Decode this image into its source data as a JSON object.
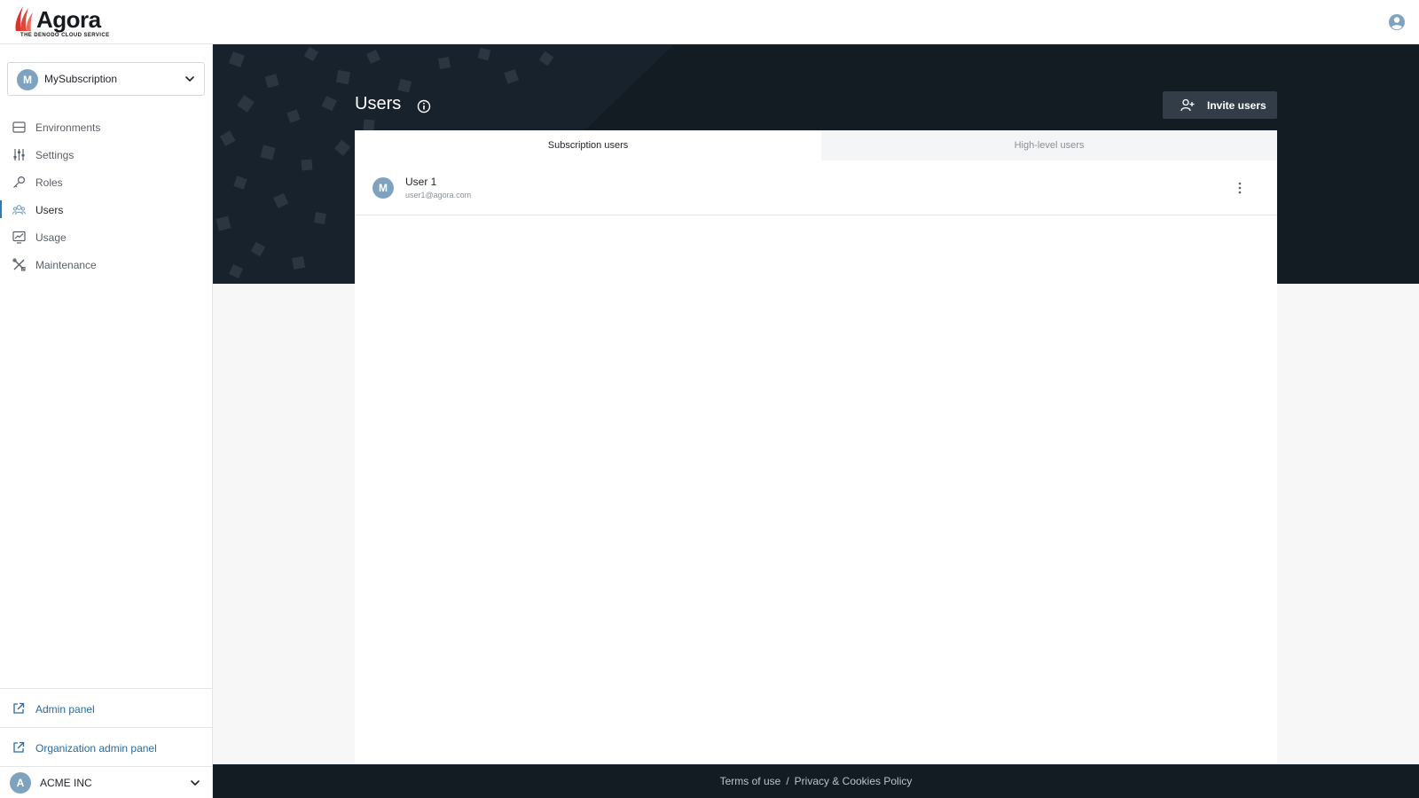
{
  "header": {
    "brand_name": "Agora",
    "brand_tagline": "THE DENODO CLOUD SERVICE",
    "profile_icon": "user-circle-icon"
  },
  "sidebar": {
    "subscription": {
      "initial": "M",
      "name": "MySubscription"
    },
    "items": [
      {
        "label": "Environments",
        "icon": "environments-icon",
        "active": false
      },
      {
        "label": "Settings",
        "icon": "sliders-icon",
        "active": false
      },
      {
        "label": "Roles",
        "icon": "key-icon",
        "active": false
      },
      {
        "label": "Users",
        "icon": "users-icon",
        "active": true
      },
      {
        "label": "Usage",
        "icon": "usage-chart-icon",
        "active": false
      },
      {
        "label": "Maintenance",
        "icon": "tools-icon",
        "active": false
      }
    ],
    "admin_panel_label": "Admin panel",
    "org_admin_panel_label": "Organization admin panel",
    "organization": {
      "initial": "A",
      "name": "ACME INC"
    }
  },
  "main": {
    "title": "Users",
    "invite_label": "Invite users",
    "tabs": [
      {
        "label": "Subscription users",
        "active": true
      },
      {
        "label": "High-level users",
        "active": false
      }
    ],
    "users": [
      {
        "initial": "M",
        "name": "User 1",
        "email": "user1@agora.com"
      }
    ]
  },
  "footer": {
    "terms_label": "Terms of use",
    "separator": "/",
    "privacy_label": "Privacy & Cookies Policy"
  },
  "colors": {
    "hero_background": "#131b23",
    "avatar": "#7fa3bf",
    "link": "#2a6a9e",
    "accent": "#2e7ab8"
  }
}
